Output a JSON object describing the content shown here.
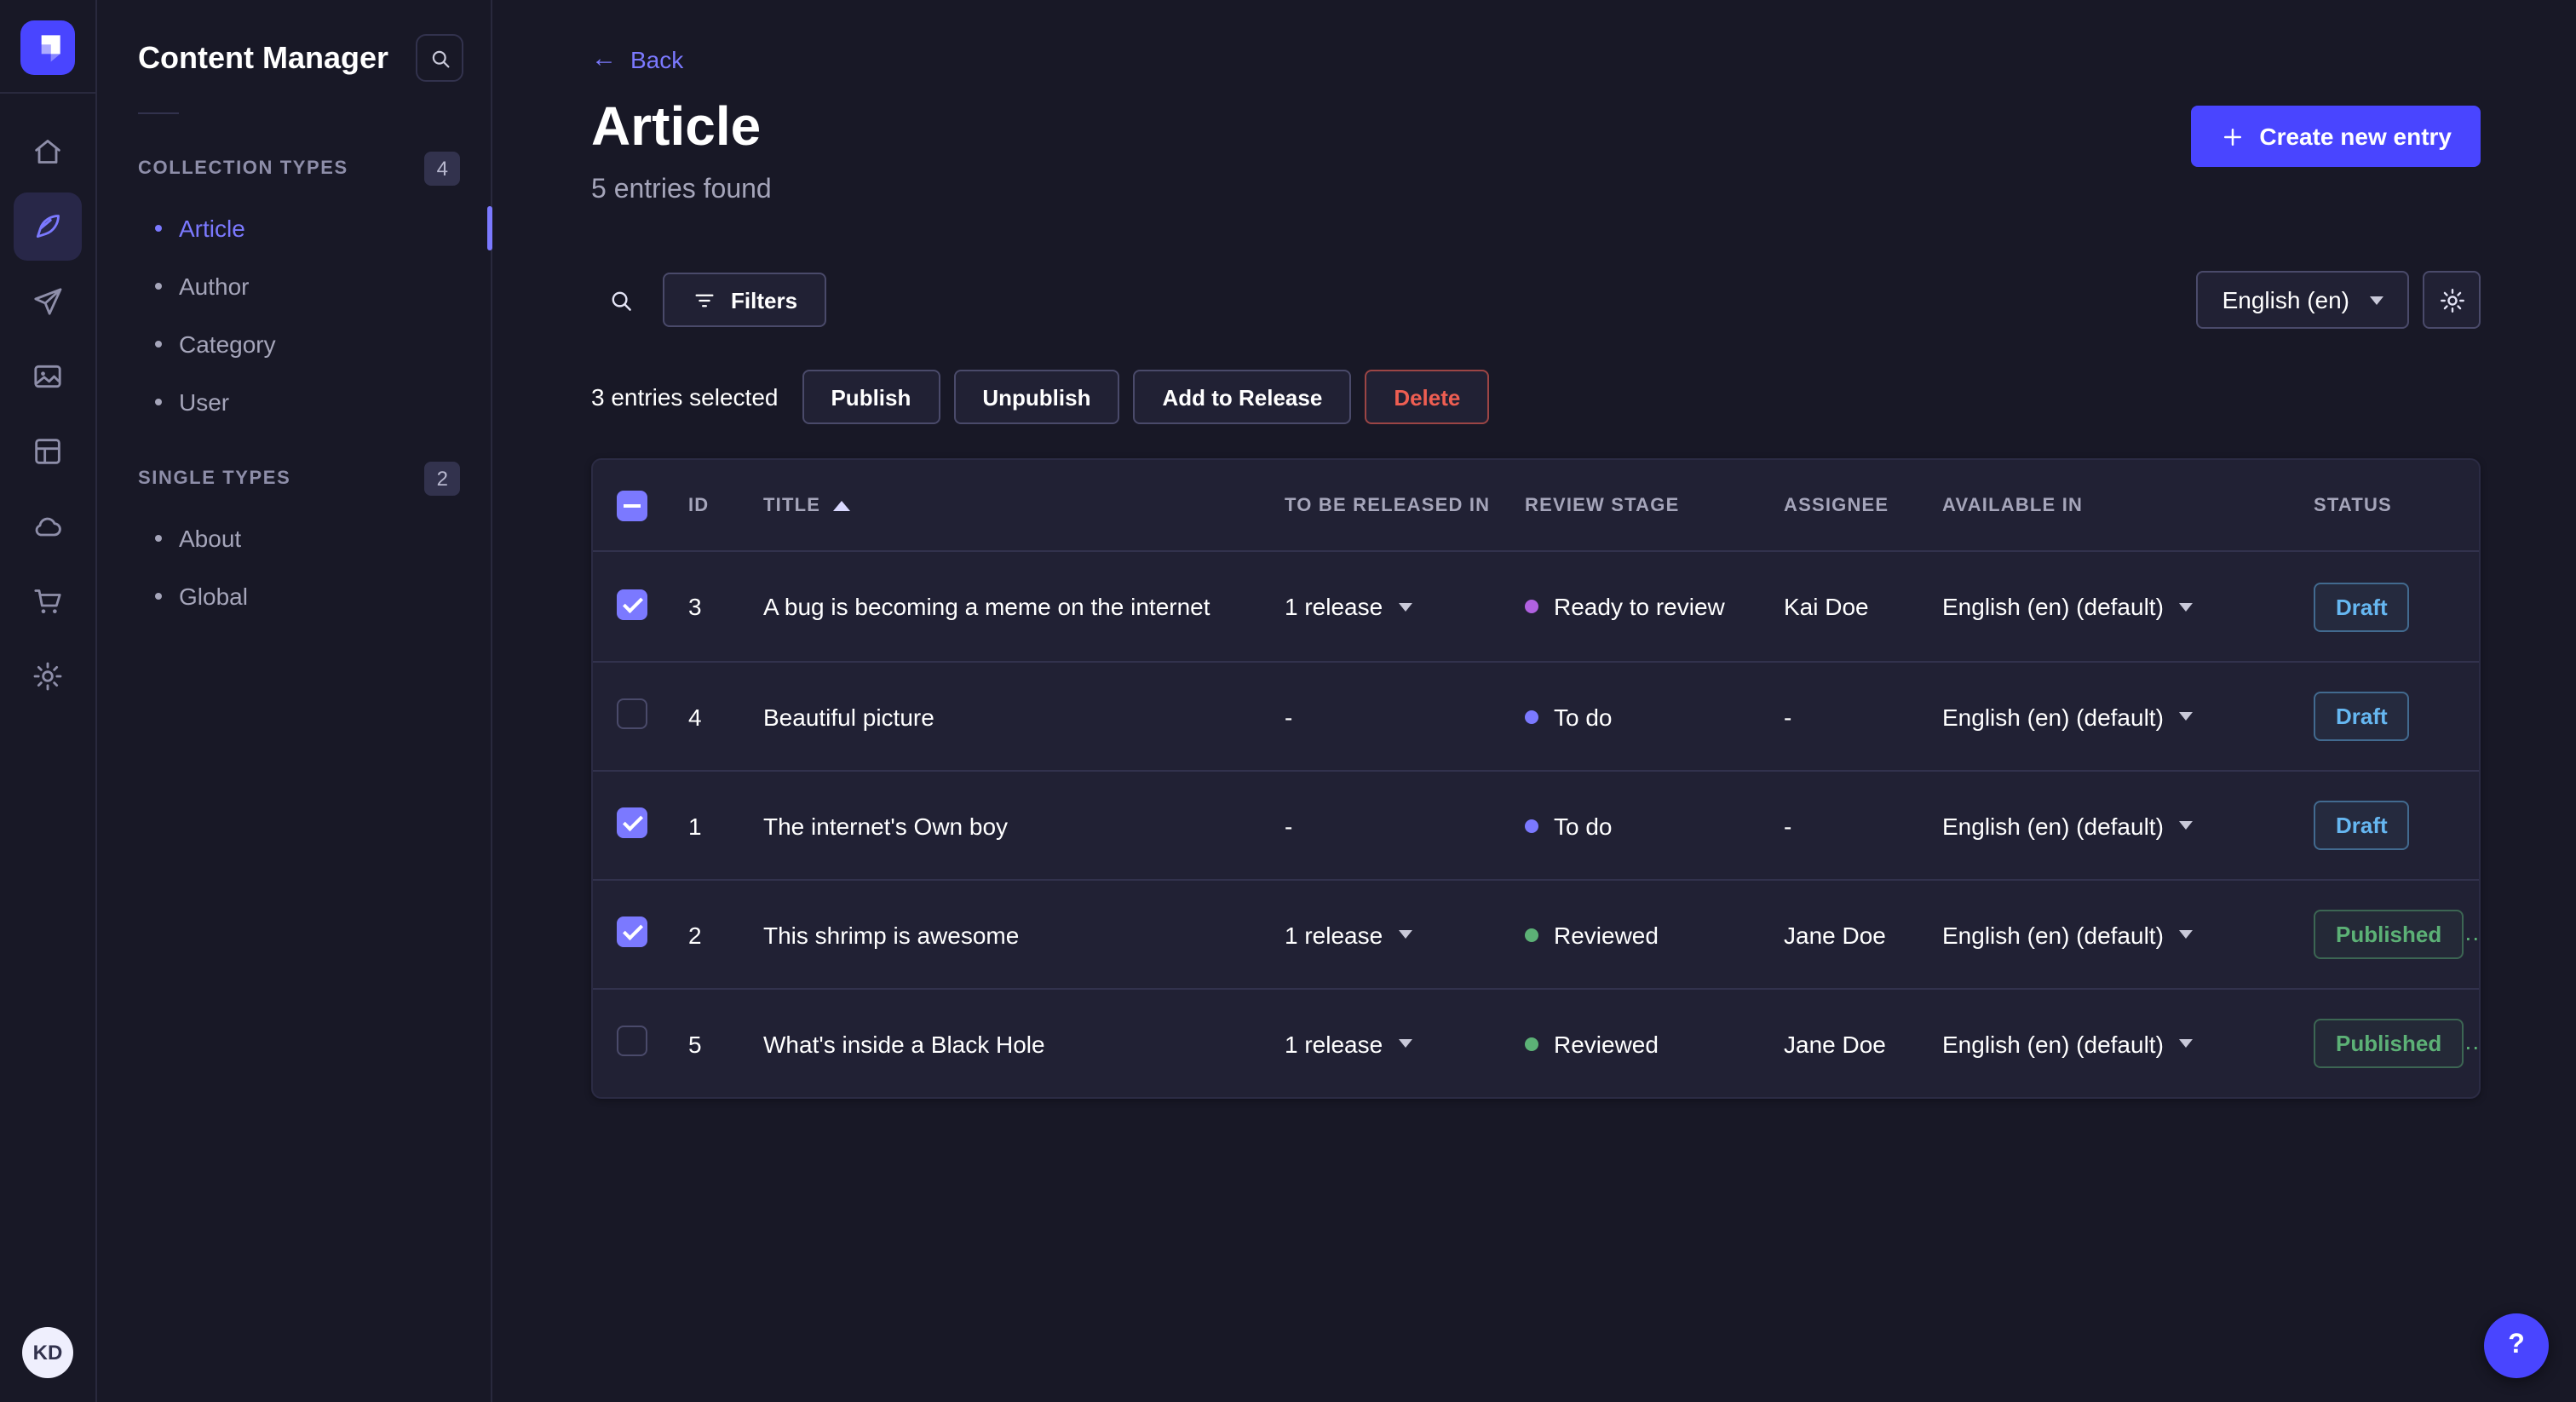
{
  "app": {
    "help_label": "?"
  },
  "colors": {
    "background": "#181826",
    "surface": "#212134",
    "primary": "#4945ff",
    "primary_light": "#7b79ff",
    "success": "#5cb176",
    "draft": "#66b7f1",
    "danger": "#ee5e52",
    "text_muted": "#a5a5ba"
  },
  "rail": {
    "avatar_initials": "KD",
    "icons": [
      "strapi-logo",
      "home-icon",
      "content-manager-icon",
      "releases-icon",
      "media-library-icon",
      "content-type-builder-icon",
      "cloud-icon",
      "marketplace-icon",
      "settings-icon"
    ],
    "active_item": "content-manager"
  },
  "subnav": {
    "title": "Content Manager",
    "sections": [
      {
        "label": "COLLECTION TYPES",
        "badge": "4",
        "items": [
          {
            "label": "Article",
            "active": true
          },
          {
            "label": "Author",
            "active": false
          },
          {
            "label": "Category",
            "active": false
          },
          {
            "label": "User",
            "active": false
          }
        ]
      },
      {
        "label": "SINGLE TYPES",
        "badge": "2",
        "items": [
          {
            "label": "About",
            "active": false
          },
          {
            "label": "Global",
            "active": false
          }
        ]
      }
    ]
  },
  "header": {
    "back_label": "Back",
    "back_arrow": "←",
    "title": "Article",
    "subtitle": "5 entries found",
    "create_label": "Create new entry"
  },
  "toolbar": {
    "filters_label": "Filters",
    "locale": "English (en)"
  },
  "selection": {
    "text": "3 entries selected",
    "publish": "Publish",
    "unpublish": "Unpublish",
    "add_to_release": "Add to Release",
    "delete": "Delete"
  },
  "table": {
    "headers": [
      "ID",
      "TITLE",
      "TO BE RELEASED IN",
      "REVIEW STAGE",
      "ASSIGNEE",
      "AVAILABLE IN",
      "STATUS"
    ],
    "sorted_column": "TITLE",
    "sort_direction": "ascending",
    "rows": [
      {
        "checked": true,
        "id": "3",
        "title": "A bug is becoming a meme on the internet",
        "release": "1 release",
        "release_caret": true,
        "stage": "Ready to review",
        "stage_color": "#b061e0",
        "assignee": "Kai Doe",
        "locale": "English (en) (default)",
        "status": "Draft",
        "status_variant": "draft"
      },
      {
        "checked": false,
        "id": "4",
        "title": "Beautiful picture",
        "release": "-",
        "release_caret": false,
        "stage": "To do",
        "stage_color": "#7b79ff",
        "assignee": "-",
        "locale": "English (en) (default)",
        "status": "Draft",
        "status_variant": "draft"
      },
      {
        "checked": true,
        "id": "1",
        "title": "The internet's Own boy",
        "release": "-",
        "release_caret": false,
        "stage": "To do",
        "stage_color": "#7b79ff",
        "assignee": "-",
        "locale": "English (en) (default)",
        "status": "Draft",
        "status_variant": "draft"
      },
      {
        "checked": true,
        "id": "2",
        "title": "This shrimp is awesome",
        "release": "1 release",
        "release_caret": true,
        "stage": "Reviewed",
        "stage_color": "#5cb176",
        "assignee": "Jane Doe",
        "locale": "English (en) (default)",
        "status": "Published",
        "status_variant": "published"
      },
      {
        "checked": false,
        "id": "5",
        "title": "What's inside a Black Hole",
        "release": "1 release",
        "release_caret": true,
        "stage": "Reviewed",
        "stage_color": "#5cb176",
        "assignee": "Jane Doe",
        "locale": "English (en) (default)",
        "status": "Published",
        "status_variant": "published"
      }
    ]
  }
}
